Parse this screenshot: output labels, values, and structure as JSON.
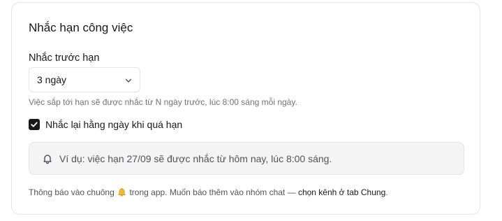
{
  "card": {
    "title": "Nhắc hạn công việc"
  },
  "reminder": {
    "label": "Nhắc trước hạn",
    "select_value": "3 ngày",
    "hint": "Việc sắp tới hạn sẽ được nhắc từ N ngày trước, lúc 8:00 sáng mỗi ngày."
  },
  "overdue": {
    "checked": true,
    "label": "Nhắc lại hằng ngày khi quá hạn"
  },
  "example": {
    "icon": "bell-icon",
    "text": "Ví dụ: việc hạn 27/09 sẽ được nhắc từ hôm nay, lúc 8:00 sáng."
  },
  "footer": {
    "text_before": "Thông báo vào chuông",
    "emoji_icon": "bell-emoji",
    "text_after": "trong app. Muốn báo thêm vào nhóm chat —",
    "link": "chọn kênh ở tab Chung",
    "end": "."
  },
  "colors": {
    "checkbox": "#18181b",
    "example_bg": "#f4f4f5",
    "border": "#e4e4e7"
  }
}
